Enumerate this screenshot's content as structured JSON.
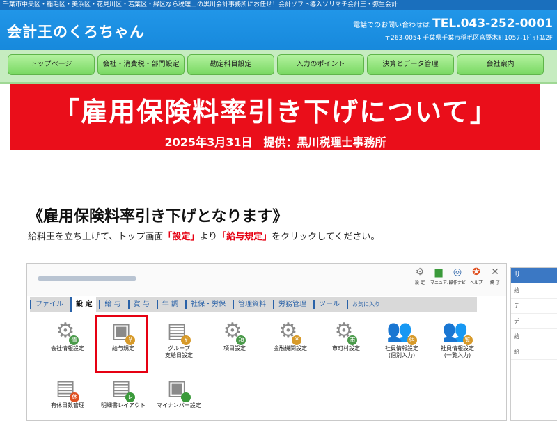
{
  "topbar": {
    "text": "千葉市中央区・稲毛区・美浜区・花見川区・若葉区・緑区なら税理士の黒川会計事務所にお任せ！会計ソフト導入ソリマチ会計王・弥生会計"
  },
  "header": {
    "logo": "会計王のくろちゃん",
    "contact_label": "電話でのお問い合わせは",
    "tel": "TEL.043-252-0001",
    "address": "〒263-0054 千葉県千葉市稲毛区宮野木町1057-1ﾄﾞｯﾄｺﾑ2F"
  },
  "nav": [
    "トップページ",
    "会社・消費税・部門設定",
    "勘定科目設定",
    "入力のポイント",
    "決算とデータ管理",
    "会社案内"
  ],
  "banner": {
    "title": "「雇用保険料率引き下げについて」",
    "subtitle": "2025年3月31日　提供：黒川税理士事務所"
  },
  "section": {
    "title": "《雇用保険料率引き下げとなります》",
    "instruction_pre": "給料王を立ち上げて、トップ画面",
    "instruction_em1": "「設定」",
    "instruction_mid": "より",
    "instruction_em2": "「給与規定」",
    "instruction_post": "をクリックしてください。"
  },
  "app": {
    "toolbar": [
      {
        "label": "設 定",
        "icon": "gear-icon",
        "glyph": "⚙",
        "color": "#7a7a7a"
      },
      {
        "label": "マニュアル",
        "icon": "book-icon",
        "glyph": "▆",
        "color": "#3a9a3a"
      },
      {
        "label": "操作ナビ",
        "icon": "compass-icon",
        "glyph": "◎",
        "color": "#2a62a8"
      },
      {
        "label": "ヘルプ",
        "icon": "lifebuoy-icon",
        "glyph": "✪",
        "color": "#e05020"
      },
      {
        "label": "終 了",
        "icon": "close-icon",
        "glyph": "✕",
        "color": "#666666"
      }
    ],
    "menu": [
      "ファイル",
      "設 定",
      "給 与",
      "賞 与",
      "年 調",
      "社保・労保",
      "管理資料",
      "労務管理",
      "ツール",
      "お気に入り"
    ],
    "active_menu": "設 定",
    "icons_row1": [
      {
        "label": "会社情報設定",
        "badge": "情",
        "icon": "company-settings-icon"
      },
      {
        "label": "給与規定",
        "badge": "¥",
        "icon": "payroll-rules-icon"
      },
      {
        "label": "グループ\n支給日設定",
        "badge": "¥",
        "icon": "group-payday-icon"
      },
      {
        "label": "項目設定",
        "badge": "項",
        "icon": "item-settings-icon"
      },
      {
        "label": "金融機関設定",
        "badge": "¥",
        "icon": "bank-settings-icon"
      },
      {
        "label": "市町村設定",
        "badge": "市",
        "icon": "municipality-settings-icon"
      },
      {
        "label": "社員情報設定\n(個別入力)",
        "badge": "個",
        "icon": "employee-individual-icon"
      },
      {
        "label": "社員情報設定\n(一覧入力)",
        "badge": "覧",
        "icon": "employee-list-icon"
      }
    ],
    "icons_row2": [
      {
        "label": "有休日数管理",
        "badge": "休",
        "icon": "paid-leave-icon"
      },
      {
        "label": "明細書レイアウト",
        "badge": "レ",
        "icon": "statement-layout-icon"
      },
      {
        "label": "マイナンバー設定",
        "badge": "",
        "icon": "mynumber-icon"
      }
    ]
  },
  "sidepanel": {
    "head": "サ",
    "rows": [
      "給",
      "デ",
      "デ",
      "給",
      "給"
    ]
  }
}
